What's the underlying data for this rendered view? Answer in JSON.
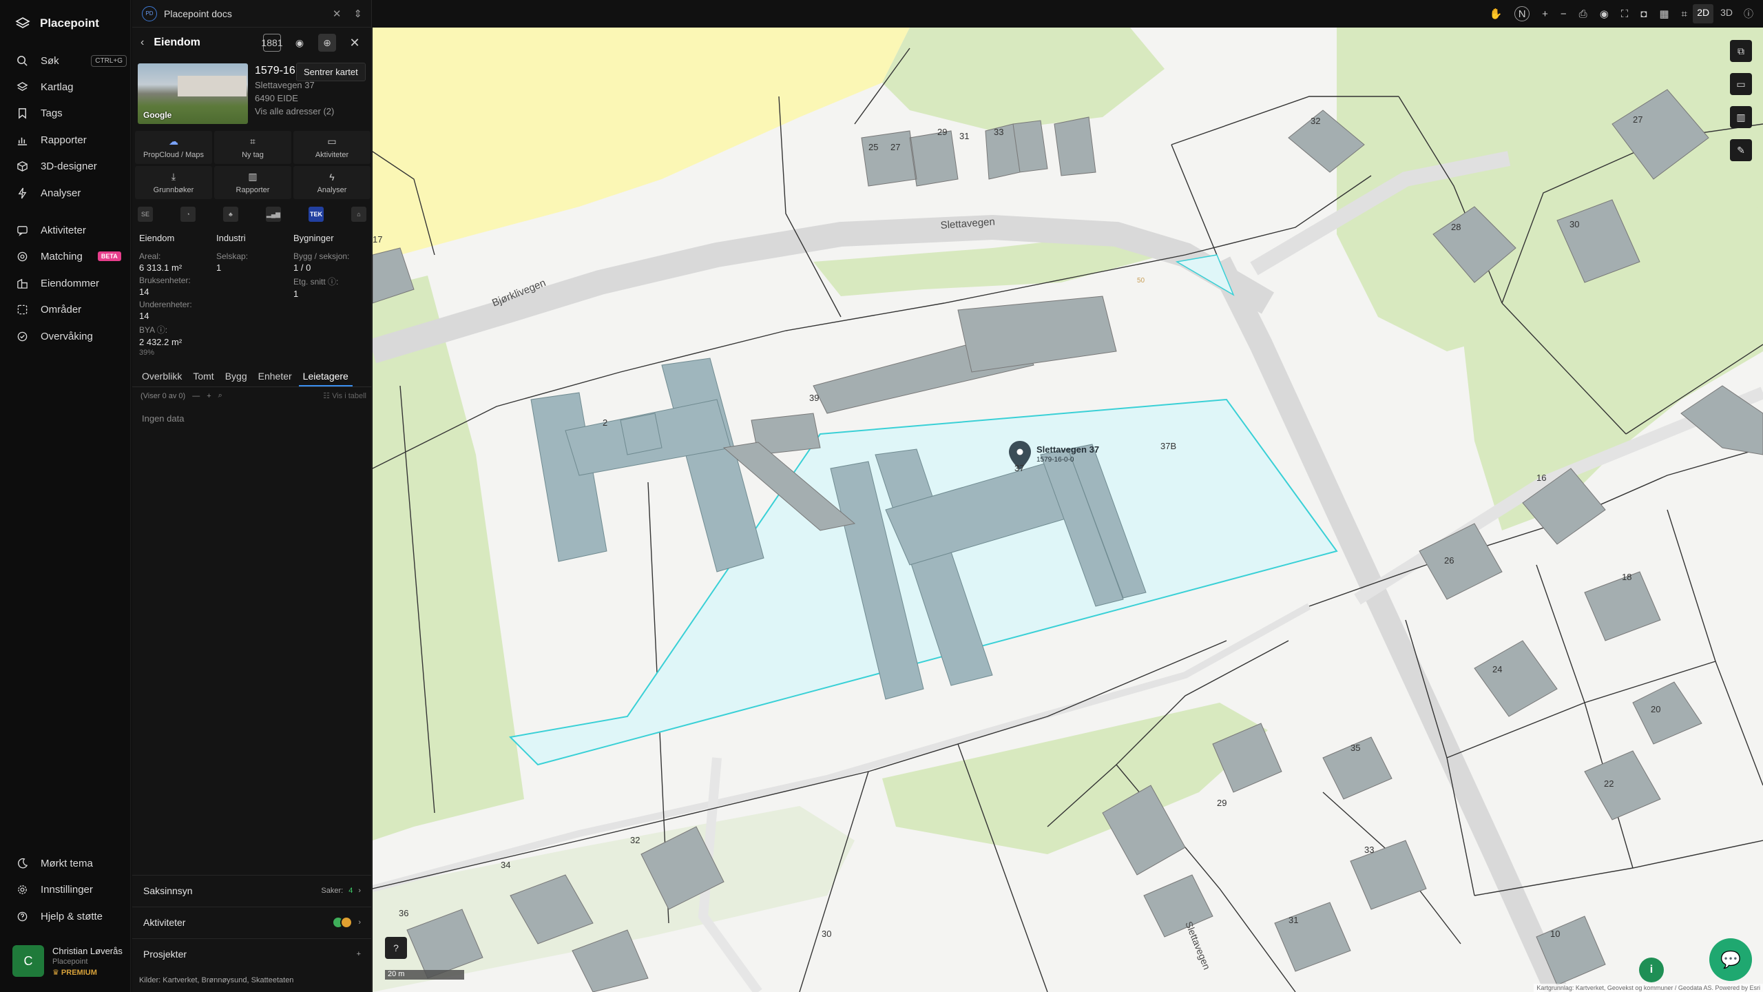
{
  "app": {
    "name": "Placepoint"
  },
  "nav": {
    "items": [
      {
        "label": "Søk",
        "shortcut": "CTRL+G",
        "icon": "search-icon"
      },
      {
        "label": "Kartlag",
        "icon": "layers-icon"
      },
      {
        "label": "Tags",
        "icon": "bookmark-icon"
      },
      {
        "label": "Rapporter",
        "icon": "chart-icon"
      },
      {
        "label": "3D-designer",
        "icon": "cube-icon"
      },
      {
        "label": "Analyser",
        "icon": "bolt-icon"
      },
      {
        "label": "Aktiviteter",
        "icon": "activity-icon"
      },
      {
        "label": "Matching",
        "badge": "BETA",
        "icon": "match-icon"
      },
      {
        "label": "Eiendommer",
        "icon": "buildings-icon"
      },
      {
        "label": "Områder",
        "icon": "area-icon"
      },
      {
        "label": "Overvåking",
        "icon": "watch-icon"
      }
    ],
    "bottom": [
      {
        "label": "Mørkt tema",
        "icon": "moon-icon"
      },
      {
        "label": "Innstillinger",
        "icon": "gear-icon"
      },
      {
        "label": "Hjelp & støtte",
        "icon": "help-icon"
      }
    ],
    "user": {
      "initial": "C",
      "name": "Christian Løverås",
      "org": "Placepoint",
      "plan": "PREMIUM"
    }
  },
  "panel": {
    "doc_badge": "PD",
    "doc_title": "Placepoint docs",
    "header_title": "Eiendom",
    "badge_1881": "1881",
    "tooltip": "Sentrer kartet",
    "thumb_tag": "Google",
    "property": {
      "id": "1579-16",
      "address": "Slettavegen 37",
      "postal": "6490 EIDE",
      "all_addresses": "Vis alle adresser (2)"
    },
    "quick": [
      {
        "label": "PropCloud / Maps",
        "icon": "cloud-icon"
      },
      {
        "label": "Ny tag",
        "icon": "bookmark-icon"
      },
      {
        "label": "Aktiviteter",
        "icon": "message-icon"
      },
      {
        "label": "Grunnbøker",
        "icon": "download-icon"
      },
      {
        "label": "Rapporter",
        "icon": "chart-icon"
      },
      {
        "label": "Analyser",
        "icon": "bolt-icon"
      }
    ],
    "sources_row": [
      "SE",
      "◔",
      "♣",
      "▂▄▆",
      "TEK",
      "⌂"
    ],
    "stats": {
      "col1": {
        "head": "Eiendom",
        "areal_label": "Areal:",
        "areal_value": "6 313.1 m²",
        "bruks_label": "Bruksenheter:",
        "bruks_value": "14",
        "under_label": "Underenheter:",
        "under_value": "14",
        "bya_label": "BYA ⓘ:",
        "bya_value": "2 432.2 m²",
        "bya_pct": "39%"
      },
      "col2": {
        "head": "Industri",
        "selskap_label": "Selskap:",
        "selskap_value": "1"
      },
      "col3": {
        "head": "Bygninger",
        "bygg_label": "Bygg / seksjon:",
        "bygg_value": "1 / 0",
        "etg_label": "Etg. snitt ⓘ:",
        "etg_value": "1"
      }
    },
    "tabs": [
      "Overblikk",
      "Tomt",
      "Bygg",
      "Enheter",
      "Leietagere"
    ],
    "active_tab": "Leietagere",
    "list_bar": {
      "count": "(Viser 0 av 0)",
      "view_table": "Vis i tabell"
    },
    "no_data": "Ingen data",
    "accordions": {
      "saksinnsyn": {
        "label": "Saksinnsyn",
        "meta_label": "Saker:",
        "meta_value": "4"
      },
      "aktiviteter": {
        "label": "Aktiviteter"
      },
      "prosjekter": {
        "label": "Prosjekter"
      }
    },
    "sources": {
      "label": "Kilder:",
      "items": [
        "Kartverket,",
        "Brønnøysund,",
        "Skatteetaten"
      ]
    }
  },
  "topbar": {
    "north": "N",
    "dim_2d": "2D",
    "dim_3d": "3D"
  },
  "map": {
    "marker_title": "Slettavegen 37",
    "marker_sub": "1579-16-0-0",
    "street_labels": [
      "Slettavegen",
      "Bjørklivegen",
      "Slettavegen"
    ],
    "house_numbers": [
      "25",
      "27",
      "29",
      "31",
      "33",
      "32",
      "27",
      "28",
      "30",
      "17",
      "2",
      "39",
      "37",
      "37B",
      "16",
      "26",
      "18",
      "24",
      "20",
      "22",
      "35",
      "29",
      "33",
      "31",
      "32",
      "34",
      "36",
      "30",
      "10"
    ],
    "contour_label": "50",
    "scale": "20 m",
    "attribution": "Kartgrunnlag: Kartverket, Geovekst og kommuner / Geodata AS. Powered by Esri"
  },
  "colors": {
    "accent": "#3a8ff0",
    "parcel": "#3fd6d6",
    "building": "#9fb6bd",
    "green": "#d8e9bf",
    "yellow": "#fbf7b5"
  }
}
